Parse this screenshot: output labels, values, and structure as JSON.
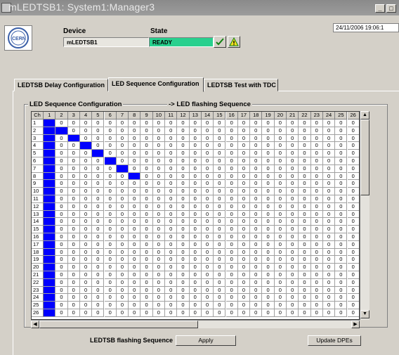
{
  "window": {
    "title": "mLEDTSB1: System1:Manager3"
  },
  "header": {
    "device_label": "Device",
    "device_value": "mLEDTSB1",
    "state_label": "State",
    "state_value": "READY",
    "state_color": "#28d08e",
    "datetime": "24/11/2006  19:06:1"
  },
  "tabs": [
    {
      "label": "LEDTSB Delay Configuration"
    },
    {
      "label": "LED Sequence Configuration",
      "active": true
    },
    {
      "label": "LEDTSB Test with TDC"
    }
  ],
  "panel": {
    "group_title": "LED Sequence Configuration",
    "sequence_title": "-> LED flashing Sequence"
  },
  "grid": {
    "corner_label": "Ch",
    "columns": [
      "1",
      "2",
      "3",
      "4",
      "5",
      "6",
      "7",
      "8",
      "9",
      "10",
      "11",
      "12",
      "13",
      "14",
      "15",
      "16",
      "17",
      "18",
      "19",
      "20",
      "21",
      "22",
      "23",
      "24",
      "25",
      "26"
    ],
    "rows": [
      "1",
      "2",
      "3",
      "4",
      "5",
      "6",
      "7",
      "8",
      "9",
      "10",
      "11",
      "12",
      "13",
      "14",
      "15",
      "16",
      "17",
      "18",
      "19",
      "20",
      "21",
      "22",
      "23",
      "24",
      "25",
      "26"
    ],
    "cell_value": "0",
    "active_color": "#0000ff",
    "active_cells": [
      [
        1,
        1
      ],
      [
        2,
        1
      ],
      [
        2,
        2
      ],
      [
        3,
        1
      ],
      [
        3,
        3
      ],
      [
        4,
        1
      ],
      [
        4,
        4
      ],
      [
        5,
        1
      ],
      [
        5,
        5
      ],
      [
        6,
        1
      ],
      [
        6,
        6
      ],
      [
        7,
        1
      ],
      [
        7,
        7
      ],
      [
        8,
        1
      ],
      [
        8,
        8
      ],
      [
        9,
        1
      ],
      [
        10,
        1
      ],
      [
        11,
        1
      ],
      [
        12,
        1
      ],
      [
        13,
        1
      ],
      [
        14,
        1
      ],
      [
        15,
        1
      ],
      [
        16,
        1
      ],
      [
        17,
        1
      ],
      [
        18,
        1
      ],
      [
        19,
        1
      ],
      [
        20,
        1
      ],
      [
        21,
        1
      ],
      [
        22,
        1
      ],
      [
        23,
        1
      ],
      [
        24,
        1
      ],
      [
        25,
        1
      ],
      [
        26,
        1
      ]
    ]
  },
  "footer": {
    "sequence_label": "LEDTSB flashing Sequence",
    "apply_button": "Apply",
    "update_button": "Update DPEs"
  }
}
